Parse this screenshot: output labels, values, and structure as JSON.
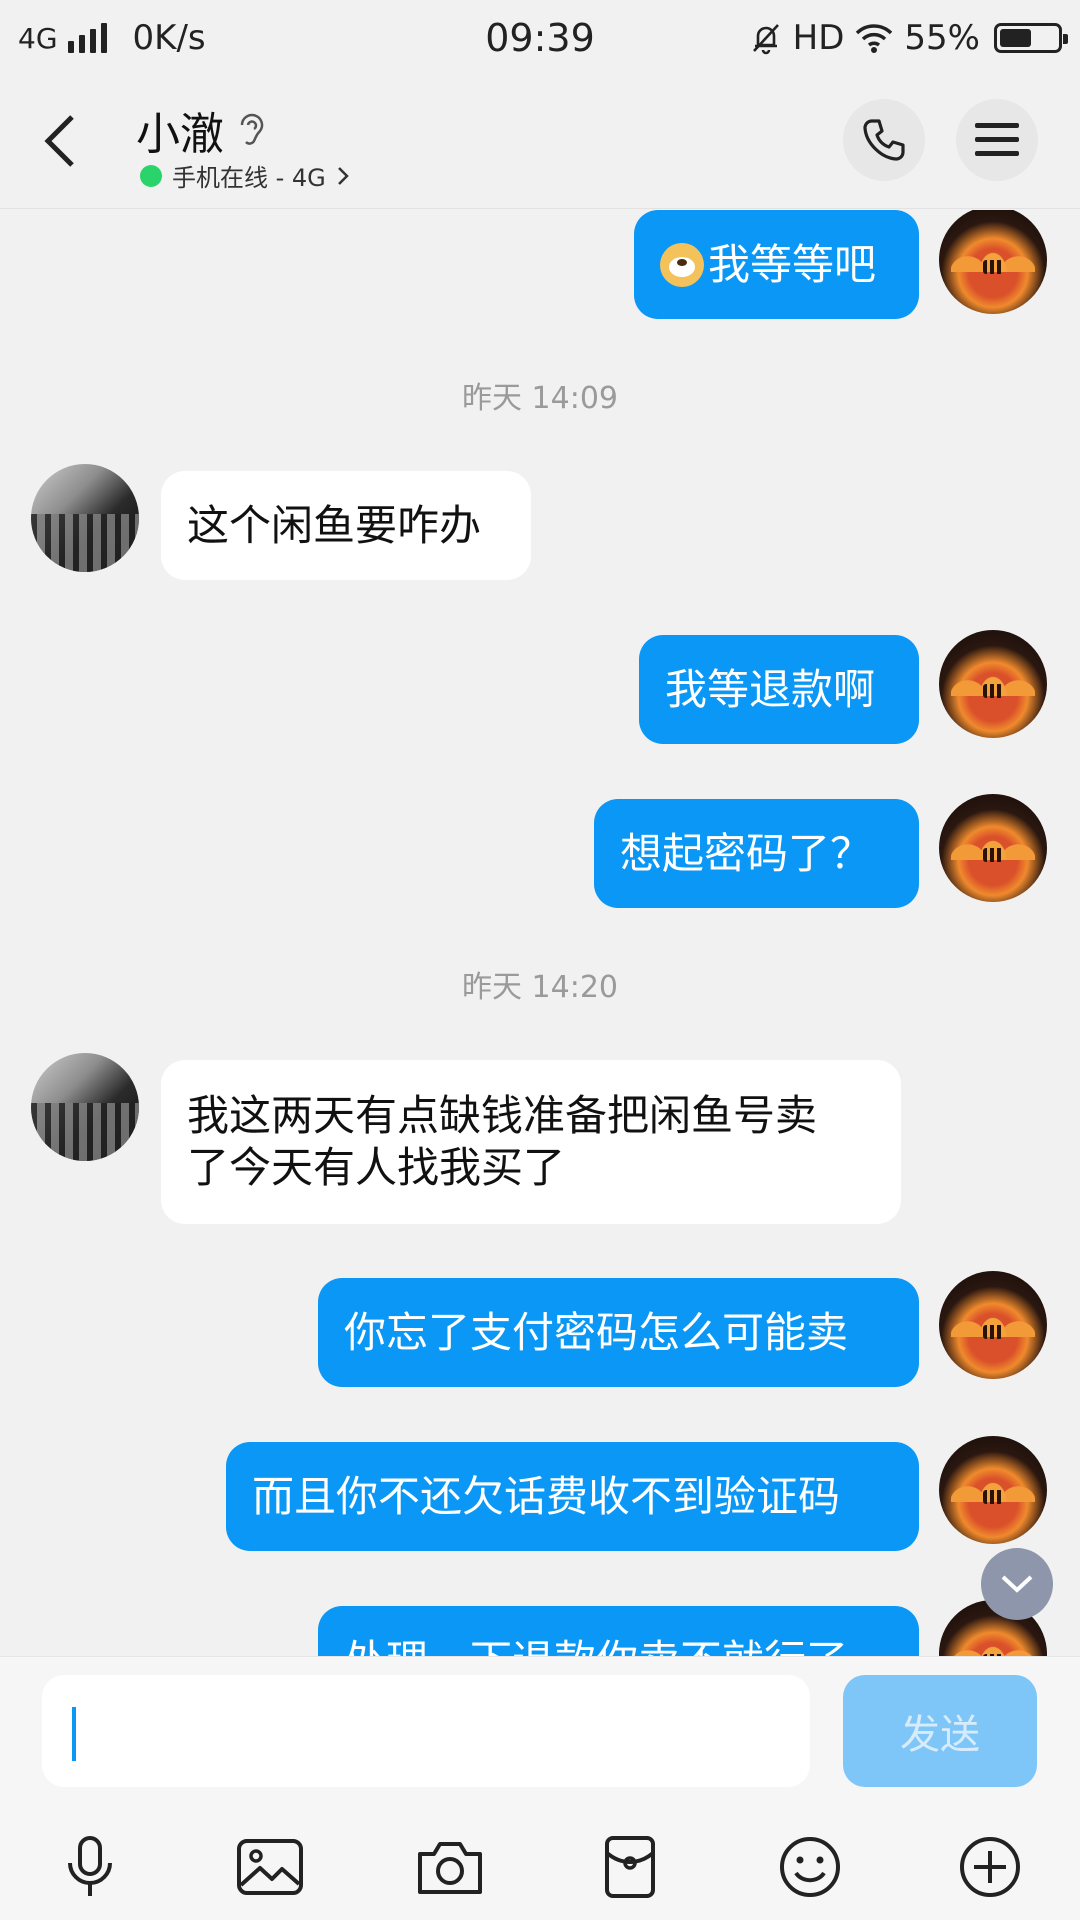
{
  "status_bar": {
    "network": "4G",
    "speed": "0K/s",
    "time": "09:39",
    "hd": "HD",
    "battery_percent": "55%",
    "battery_level": 0.55
  },
  "header": {
    "contact_name": "小澈",
    "status_text": "手机在线 - 4G",
    "status_color": "#2bd46a"
  },
  "messages": [
    {
      "side": "right",
      "text": "我等等吧",
      "has_emoji": true
    },
    {
      "type": "time",
      "text": "昨天 14:09"
    },
    {
      "side": "left",
      "text": "这个闲鱼要咋办"
    },
    {
      "side": "right",
      "text": "我等退款啊"
    },
    {
      "side": "right",
      "text": "想起密码了？"
    },
    {
      "type": "time",
      "text": "昨天 14:20"
    },
    {
      "side": "left",
      "lines": [
        "我这两天有点缺钱准备把闲鱼号卖",
        "了今天有人找我买了"
      ]
    },
    {
      "side": "right",
      "text": "你忘了支付密码怎么可能卖"
    },
    {
      "side": "right",
      "text": "而且你不还欠话费收不到验证码"
    },
    {
      "side": "right",
      "text": "处理一下退款你卖不就行了"
    }
  ],
  "input": {
    "value": "",
    "send_label": "发送"
  },
  "toolbar": {
    "icons": [
      "microphone-icon",
      "image-icon",
      "camera-icon",
      "red-packet-icon",
      "emoji-icon",
      "plus-icon"
    ]
  },
  "colors": {
    "my_bubble": "#0a97f5",
    "other_bubble": "#ffffff",
    "send_button": "#7fc6f8"
  }
}
